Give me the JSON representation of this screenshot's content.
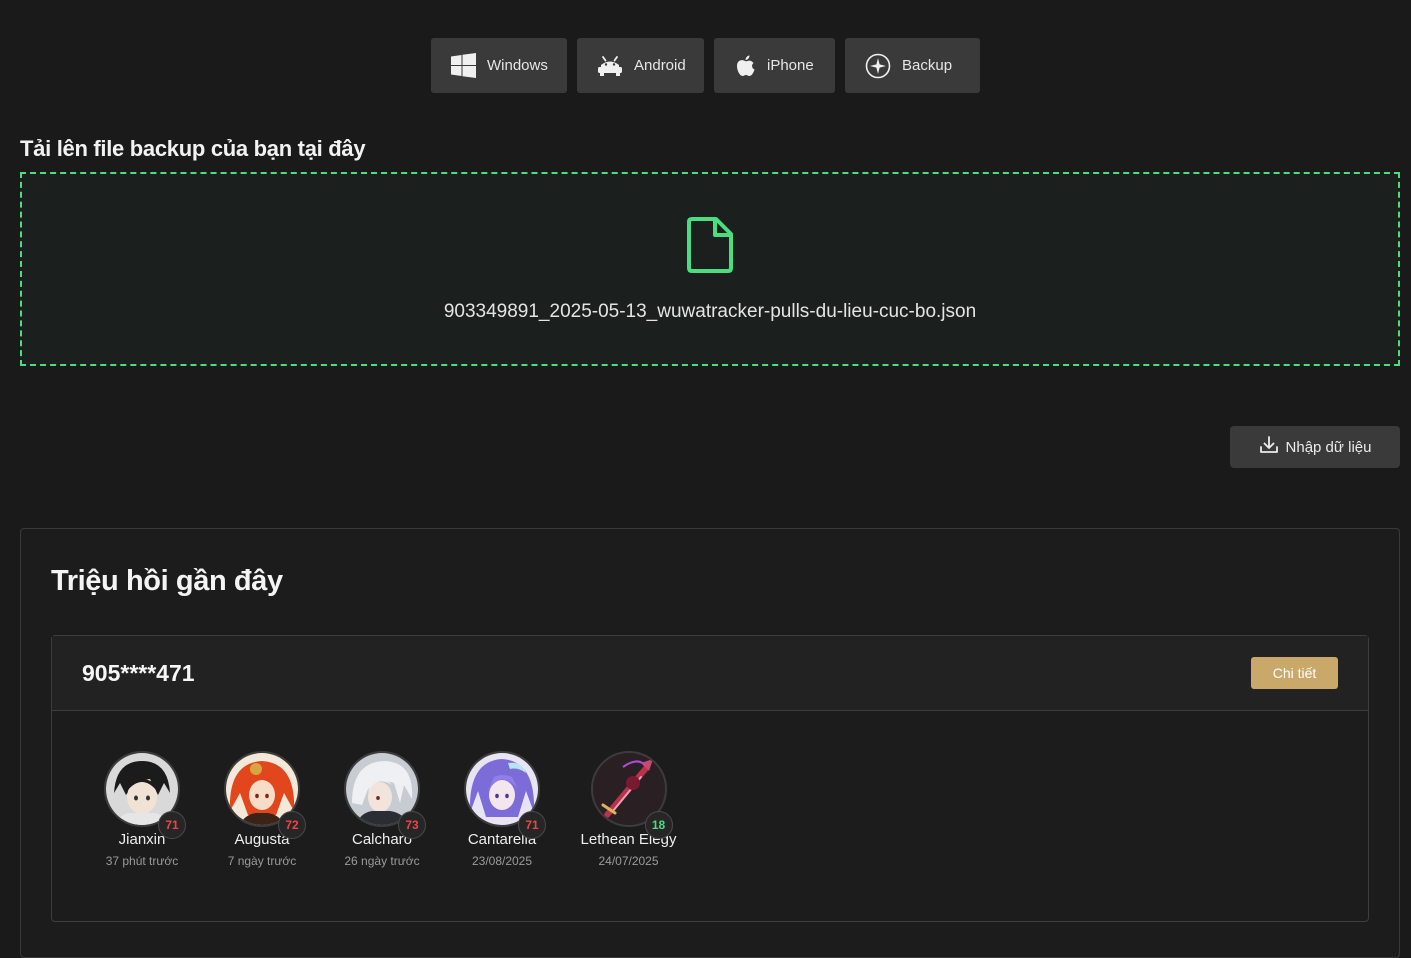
{
  "platforms": [
    {
      "label": "Windows",
      "icon": "windows-icon"
    },
    {
      "label": "Android",
      "icon": "android-icon"
    },
    {
      "label": "iPhone",
      "icon": "apple-icon"
    },
    {
      "label": "Backup",
      "icon": "backup-icon"
    }
  ],
  "upload": {
    "title": "Tải lên file backup của bạn tại đây",
    "file_name": "903349891_2025-05-13_wuwatracker-pulls-du-lieu-cuc-bo.json",
    "icon": "file-icon",
    "border_color": "#4ade80"
  },
  "import_button": {
    "label": "Nhập dữ liệu",
    "icon": "download-icon"
  },
  "recent": {
    "title": "Triệu hồi gần đây",
    "account": {
      "id": "905****471",
      "detail_label": "Chi tiết"
    },
    "pulls": [
      {
        "name": "Jianxin",
        "pity": "71",
        "time": "37 phút trước",
        "pity_color": "#ef4444"
      },
      {
        "name": "Augusta",
        "pity": "72",
        "time": "7 ngày trước",
        "pity_color": "#ef4444"
      },
      {
        "name": "Calcharo",
        "pity": "73",
        "time": "26 ngày trước",
        "pity_color": "#ef4444"
      },
      {
        "name": "Cantarella",
        "pity": "71",
        "time": "23/08/2025",
        "pity_color": "#ef4444"
      },
      {
        "name": "Lethean Elegy",
        "pity": "18",
        "time": "24/07/2025",
        "pity_color": "#4ade80"
      }
    ]
  },
  "colors": {
    "background": "#1a1a1a",
    "button": "#3a3a3a",
    "accent_gold": "#c9a869"
  }
}
